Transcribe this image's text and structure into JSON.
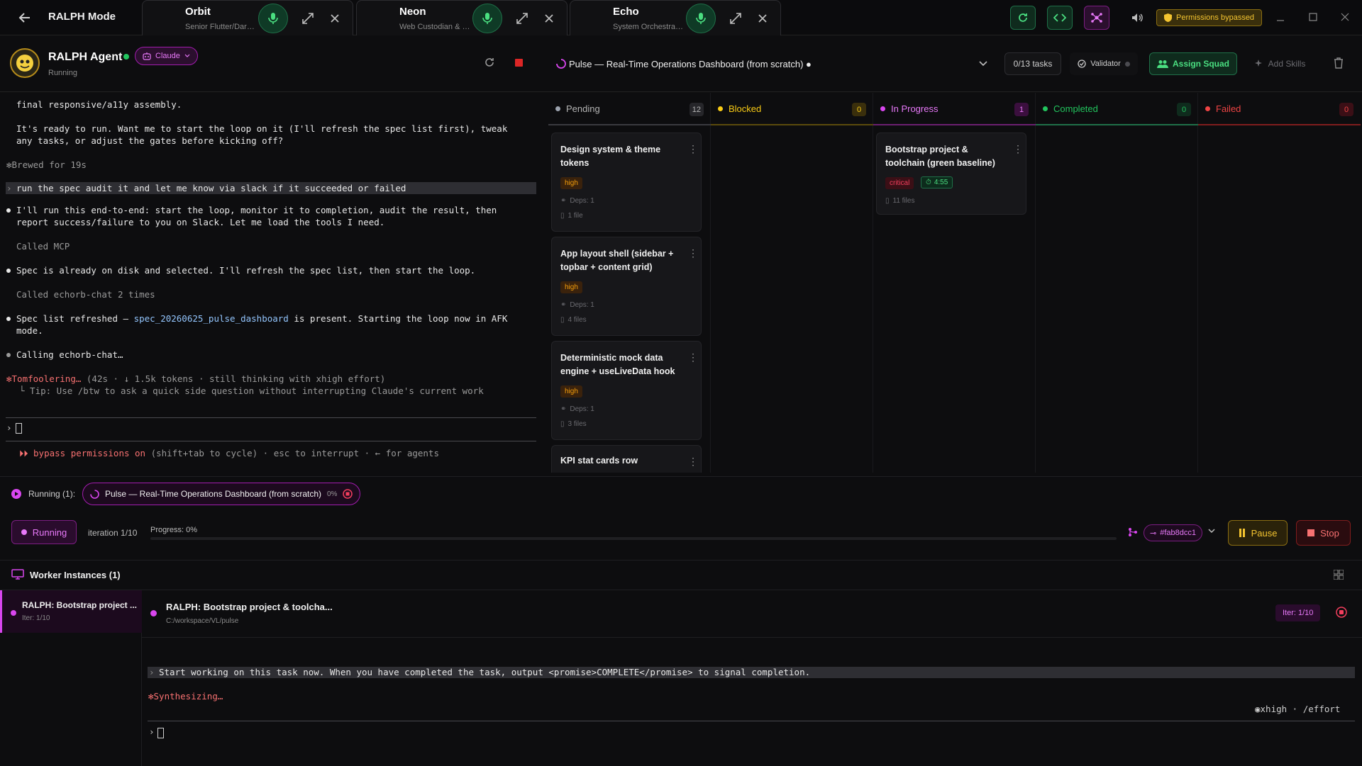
{
  "topbar": {
    "title": "RALPH Mode",
    "agents": [
      {
        "name": "Orbit",
        "role": "Senior Flutter/Dart Engineer"
      },
      {
        "name": "Neon",
        "role": "Web Custodian & Builder"
      },
      {
        "name": "Echo",
        "role": "System Orchestrator"
      }
    ],
    "permissions_label": "Permissions bypassed"
  },
  "agent": {
    "name": "RALPH Agent",
    "status": "Running",
    "model": "Claude"
  },
  "terminal": {
    "line1": "final responsive/a11y assembly.",
    "line2": "It's ready to run. Want me to start the loop on it (I'll refresh the spec list first), tweak",
    "line3": "any tasks, or adjust the gates before kicking off?",
    "brewed": "Brewed for 19s",
    "user_prompt": "run the spec audit it and let me know via slack if it succeeded or failed",
    "reply1a": "I'll run this end-to-end: start the loop, monitor it to completion, audit the result, then",
    "reply1b": "report success/failure to you on Slack. Let me load the tools I need.",
    "called_mcp": "Called MCP",
    "reply2": "Spec is already on disk and selected. I'll refresh the spec list, then start the loop.",
    "called_echorb": "Called echorb-chat 2 times",
    "reply3a_pre": "Spec list refreshed — ",
    "reply3a_link": "spec_20260625_pulse_dashboard",
    "reply3a_post": " is present. Starting the loop now in AFK",
    "reply3b": "mode.",
    "calling": "Calling echorb-chat…",
    "thinking_word": "Tomfoolering…",
    "thinking_meta": " (42s · ↓ 1.5k tokens · still thinking with xhigh effort)",
    "tip": "└ Tip: Use /btw to ask a quick side question without interrupting Claude's current work",
    "bypass_strong": "bypass permissions on",
    "bypass_rest": " (shift+tab to cycle) · esc to interrupt · ← for agents"
  },
  "spec": {
    "title": "Pulse — Real-Time Operations Dashboard (from scratch)",
    "task_count": "0/13 tasks",
    "validator_label": "Validator",
    "assign_label": "Assign Squad",
    "add_skills_label": "Add Skills"
  },
  "kanban": {
    "columns": [
      {
        "label": "Pending",
        "count": "12",
        "color": "#9ca3af"
      },
      {
        "label": "Blocked",
        "count": "0",
        "color": "#facc15"
      },
      {
        "label": "In Progress",
        "count": "1",
        "color": "#d946ef"
      },
      {
        "label": "Completed",
        "count": "0",
        "color": "#22c55e"
      },
      {
        "label": "Failed",
        "count": "0",
        "color": "#ef4444"
      }
    ],
    "pending_cards": [
      {
        "title": "Design system & theme tokens",
        "priority": "high",
        "deps": "Deps: 1",
        "files": "1 file"
      },
      {
        "title": "App layout shell (sidebar + topbar + content grid)",
        "priority": "high",
        "deps": "Deps: 1",
        "files": "4 files"
      },
      {
        "title": "Deterministic mock data engine + useLiveData hook",
        "priority": "high",
        "deps": "Deps: 1",
        "files": "3 files"
      },
      {
        "title": "KPI stat cards row"
      }
    ],
    "progress_card": {
      "title": "Bootstrap project & toolchain (green baseline)",
      "priority": "critical",
      "timer": "4:55",
      "files": "11 files"
    }
  },
  "running": {
    "label": "Running (1):",
    "spec_title": "Pulse — Real-Time Operations Dashboard (from scratch)",
    "percent": "0%"
  },
  "controls": {
    "status": "Running",
    "iteration": "iteration 1/10",
    "progress_label": "Progress: 0%",
    "progress": 0,
    "commit": "#fab8dcc1",
    "pause": "Pause",
    "stop": "Stop"
  },
  "workers": {
    "header": "Worker Instances (1)",
    "item_title": "RALPH: Bootstrap project ...",
    "item_iter": "Iter: 1/10",
    "pane_title": "RALPH: Bootstrap project & toolcha...",
    "pane_path": "C:/workspace/VL/pulse",
    "pane_iter": "Iter: 1/10",
    "prompt": "Start working on this task now. When you have completed the task, output <promise>COMPLETE</promise> to signal completion.",
    "synth": "Synthesizing…",
    "effort": "xhigh · /effort"
  }
}
